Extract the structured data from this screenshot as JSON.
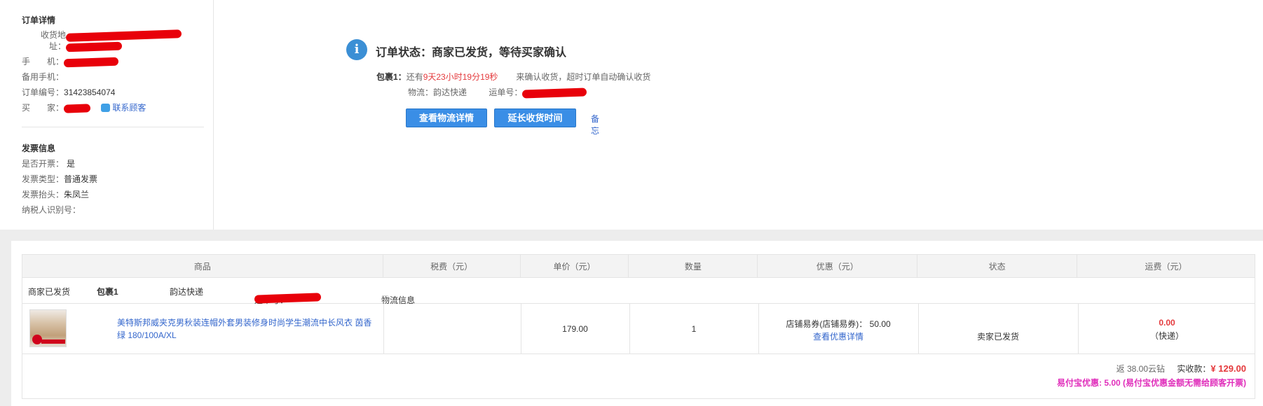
{
  "order_detail": {
    "title": "订单详情",
    "address_label_1": "收货地",
    "address_label_2": "址：",
    "phone_label": "手　　机：",
    "backup_phone_label": "备用手机：",
    "order_no_label": "订单编号：",
    "order_no": "31423854074",
    "buyer_label": "买　　家：",
    "contact_link": "联系顾客"
  },
  "invoice": {
    "title": "发票信息",
    "issue_label": "是否开票：",
    "issue_value": "是",
    "type_label": "发票类型：",
    "type_value": "普通发票",
    "header_label": "发票抬头：",
    "header_value": "朱凤兰",
    "taxid_label": "纳税人识别号："
  },
  "status": {
    "icon": "info-icon",
    "title": "订单状态：商家已发货，等待买家确认",
    "package_label": "包裹1：",
    "remaining_prefix": "还有",
    "remaining_time": "9天23小时19分19秒",
    "remaining_suffix": "来确认收货，超时订单自动确认收货",
    "logistics_label": "物流：",
    "logistics_value": "韵达快递",
    "waybill_label": "运单号："
  },
  "actions": {
    "view_logistics": "查看物流详情",
    "extend_receipt": "延长收货时间",
    "memo": "备忘"
  },
  "table": {
    "headers": [
      "商品",
      "税费（元）",
      "单价（元）",
      "数量",
      "优惠（元）",
      "状态",
      "运费（元）"
    ],
    "package_row": {
      "status": "商家已发货",
      "package": "包裹1",
      "courier": "韵达快递",
      "waybill_label": "运单号：",
      "logistics_link": "物流信息"
    },
    "item": {
      "name": "美特斯邦威夹克男秋装连帽外套男装修身时尚学生潮流中长风衣 茵香绿 180/100A/XL",
      "unit_price": "179.00",
      "quantity": "1",
      "discount_text": "店铺易券(店铺易券)： 50.00",
      "discount_link": "查看优惠详情",
      "status": "卖家已发货",
      "shipping_fee": "0.00",
      "shipping_method": "（快递）"
    },
    "summary": {
      "rebate": "返 38.00云钻",
      "paid_label": "实收款：",
      "paid_value": "¥ 129.00",
      "yifubao": "易付宝优惠: 5.00 (易付宝优惠金额无需给顾客开票)"
    }
  },
  "colors": {
    "accent_blue": "#3a8ee6",
    "price_red": "#e4393c",
    "link_blue": "#3366cc",
    "promo_pink": "#e02fbb"
  }
}
